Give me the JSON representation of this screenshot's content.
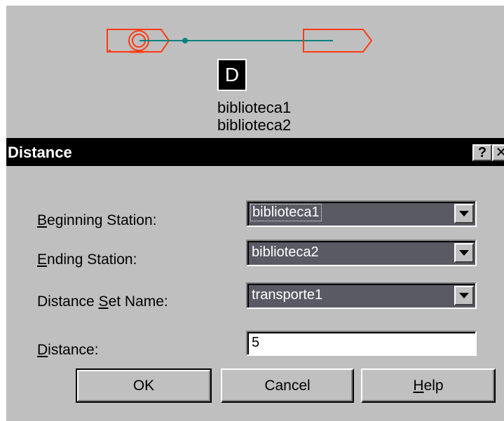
{
  "diagram": {
    "node_badge": "D",
    "station_labels": [
      "biblioteca1",
      "biblioteca2"
    ],
    "colors": {
      "station": "#ff3b14",
      "link": "#008080"
    }
  },
  "dialog": {
    "title": "Distance",
    "help_glyph": "?",
    "close_glyph": "✕",
    "fields": {
      "beginning": {
        "label_prefix": "",
        "label_key": "B",
        "label_rest": "eginning Station:",
        "value": "biblioteca1"
      },
      "ending": {
        "label_prefix": "",
        "label_key": "E",
        "label_rest": "nding Station:",
        "value": "biblioteca2"
      },
      "set_name": {
        "label_prefix": "Distance ",
        "label_key": "S",
        "label_rest": "et Name:",
        "value": "transporte1"
      },
      "distance": {
        "label_prefix": "",
        "label_key": "D",
        "label_rest": "istance:",
        "value": "5"
      }
    },
    "buttons": {
      "ok": "OK",
      "cancel": "Cancel",
      "help_key": "H",
      "help_rest": "elp"
    },
    "colors": {
      "titlebar": "#000000",
      "face": "#c0c0c0",
      "combo_bg": "#5a5a65"
    }
  }
}
